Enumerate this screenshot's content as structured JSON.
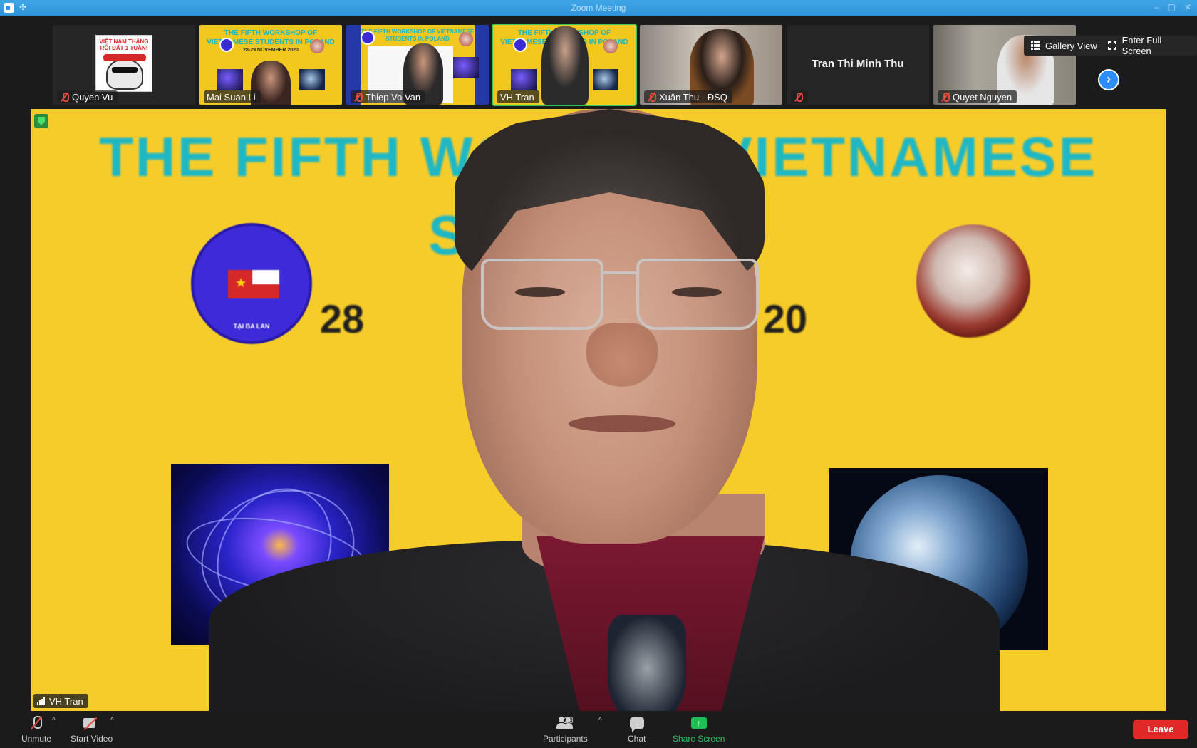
{
  "window": {
    "title": "Zoom Meeting"
  },
  "strip": {
    "participants": [
      {
        "name": "Quyen Vu",
        "muted": true,
        "tile": "avatar"
      },
      {
        "name": "Mai Suan Li",
        "muted": false,
        "tile": "poster"
      },
      {
        "name": "Thiep Vo Van",
        "muted": true,
        "tile": "poster"
      },
      {
        "name": "VH Tran",
        "muted": false,
        "tile": "poster",
        "active_speaker": true
      },
      {
        "name": "Xuân Thu - ĐSQ",
        "muted": true,
        "tile": "video"
      },
      {
        "name": "Tran Thi Minh Thu",
        "muted": true,
        "tile": "no-video"
      },
      {
        "name": "Quyet Nguyen",
        "muted": true,
        "tile": "video"
      }
    ],
    "avatar_text": "VIỆT NAM THẮNG RỒI ĐẤT 1 TUẦN!",
    "poster_title": "THE FIFTH WORKSHOP OF VIETNAMESE STUDENTS IN POLAND",
    "poster_date": "28-29 NOVEMBER 2020",
    "next_page_icon": "chevron-right-icon",
    "gallery_view_label": "Gallery View",
    "full_screen_label": "Enter Full Screen"
  },
  "main": {
    "speaker_name": "VH Tran",
    "background_title_line1": "THE FIFTH WORKS    F VIETNAMESE",
    "background_title_line2": "STUD                   LAND",
    "background_date_left": "28",
    "background_date_right": "20",
    "logo_bottom_text": "TẠI BA LAN",
    "accent_color": "#33c35a",
    "poster_color": "#f6cc2a"
  },
  "toolbar": {
    "unmute_label": "Unmute",
    "start_video_label": "Start Video",
    "participants_label": "Participants",
    "participants_count": "28",
    "chat_label": "Chat",
    "share_screen_label": "Share Screen",
    "leave_label": "Leave",
    "leave_color": "#e02828"
  }
}
